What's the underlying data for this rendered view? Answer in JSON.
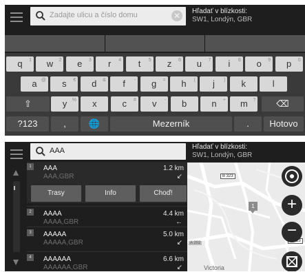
{
  "keyboard_screen": {
    "search": {
      "placeholder": "Zadajte ulicu a číslo domu"
    },
    "near": {
      "label": "Hľadať v blízkosti:",
      "location": "SW1, Londýn, GBR"
    },
    "rows": [
      [
        {
          "k": "q",
          "a": "1"
        },
        {
          "k": "w",
          "a": "2"
        },
        {
          "k": "e",
          "a": "3"
        },
        {
          "k": "r",
          "a": "4"
        },
        {
          "k": "t",
          "a": "5"
        },
        {
          "k": "z",
          "a": "6"
        },
        {
          "k": "u",
          "a": "7"
        },
        {
          "k": "i",
          "a": "8"
        },
        {
          "k": "o",
          "a": "9"
        },
        {
          "k": "p",
          "a": "0"
        }
      ],
      [
        {
          "k": "a",
          "a": "@"
        },
        {
          "k": "s",
          "a": "€"
        },
        {
          "k": "d",
          "a": "&"
        },
        {
          "k": "f",
          "a": "-"
        },
        {
          "k": "g",
          "a": "="
        },
        {
          "k": "h",
          "a": "("
        },
        {
          "k": "j",
          "a": ")"
        },
        {
          "k": "k",
          "a": ""
        },
        {
          "k": "l",
          "a": ""
        }
      ],
      [
        {
          "k": "y",
          "a": "%"
        },
        {
          "k": "x",
          "a": ""
        },
        {
          "k": "c",
          "a": "#"
        },
        {
          "k": "v",
          "a": "-"
        },
        {
          "k": "b",
          "a": ""
        },
        {
          "k": "n",
          "a": "+"
        },
        {
          "k": "m",
          "a": "?"
        }
      ]
    ],
    "special": {
      "sym": "?123",
      "comma": ",",
      "space": "Mezerník",
      "period": ".",
      "done": "Hotovo"
    }
  },
  "results_screen": {
    "search": {
      "value": "AAA"
    },
    "near": {
      "label": "Hľadať v blízkosti:",
      "location": "SW1, Londýn, GBR"
    },
    "items": [
      {
        "n": "1",
        "name": "AAA",
        "addr": "AAA,GBR",
        "dist": "1.2 km",
        "dir": "↙"
      },
      {
        "n": "2",
        "name": "AAAA",
        "addr": "AAAA,GBR",
        "dist": "4.4 km",
        "dir": "←"
      },
      {
        "n": "3",
        "name": "AAAAA",
        "addr": "AAAAA,GBR",
        "dist": "5.0 km",
        "dir": "↙"
      },
      {
        "n": "4",
        "name": "AAAAAA",
        "addr": "AAAAAA,GBR",
        "dist": "6.6 km",
        "dir": "↙"
      }
    ],
    "actions": {
      "routes": "Trasy",
      "info": "Info",
      "go": "Choď!"
    },
    "map": {
      "road1": "B 323",
      "road2": "A 202",
      "road3": "B 323",
      "place": "Victoria",
      "pin": "1"
    }
  }
}
